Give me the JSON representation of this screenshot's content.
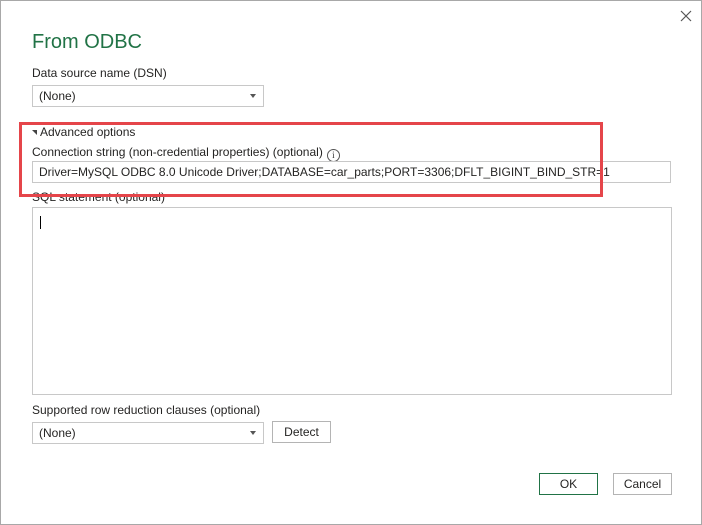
{
  "dialog": {
    "title": "From ODBC",
    "close_icon": "close-icon"
  },
  "dsn": {
    "label": "Data source name (DSN)",
    "selected": "(None)"
  },
  "advanced": {
    "toggle_label": "Advanced options",
    "expanded": true,
    "connection_string_label": "Connection string (non-credential properties) (optional)",
    "connection_string_value": "Driver=MySQL ODBC 8.0 Unicode Driver;DATABASE=car_parts;PORT=3306;DFLT_BIGINT_BIND_STR=1",
    "info_icon": "ⓘ",
    "sql_label": "SQL statement (optional)",
    "sql_value": ""
  },
  "row_reduction": {
    "label": "Supported row reduction clauses (optional)",
    "selected": "(None)",
    "detect_label": "Detect"
  },
  "footer": {
    "ok_label": "OK",
    "cancel_label": "Cancel"
  },
  "colors": {
    "title": "#217346",
    "highlight": "#e5454a"
  }
}
